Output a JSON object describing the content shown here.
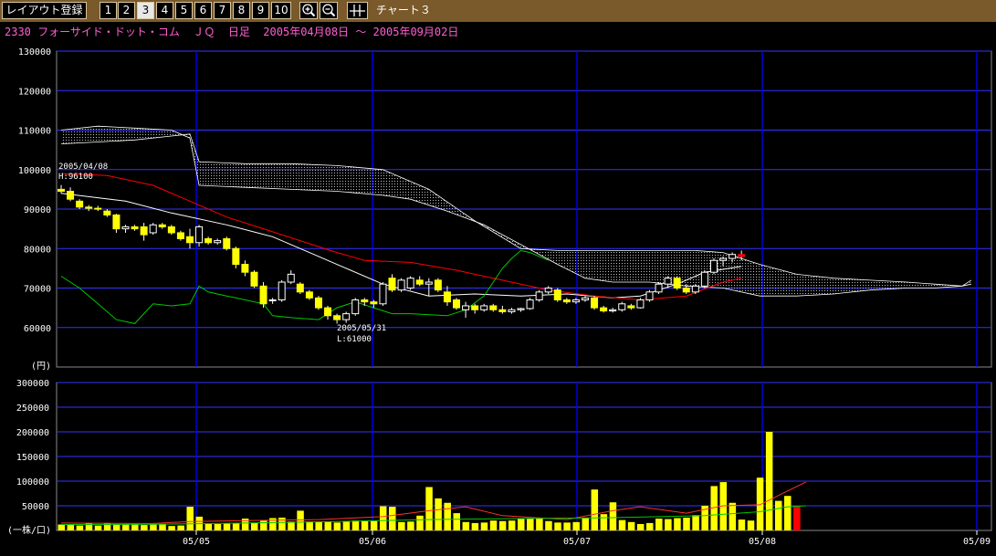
{
  "toolbar": {
    "layout_label": "レイアウト登録",
    "numbers": [
      "1",
      "2",
      "3",
      "4",
      "5",
      "6",
      "7",
      "8",
      "9",
      "10"
    ],
    "active_number": "3",
    "chart_title": "チャート３"
  },
  "header": {
    "code": "2330",
    "name": "フォーサイド・ドット・コム",
    "market": "ＪＱ",
    "period_type": "日足",
    "range": "2005年04月08日 ～ 2005年09月02日"
  },
  "colors": {
    "candle_up": "#ffffff",
    "candle_down": "#ffff00",
    "cloud": "#ffffff",
    "ma_short": "#ffffff",
    "ma_long": "#ff0000",
    "lagging_span": "#00c800",
    "volume_bar": "#ffff00",
    "volume_last": "#ff0000",
    "grid_vertical": "#0000ff",
    "grid_horizontal": "#3333ff"
  },
  "chart_data": [
    {
      "type": "candlestick",
      "yunit_label": "(円)",
      "ylim": [
        50000,
        130000
      ],
      "yticks": [
        60000,
        70000,
        80000,
        90000,
        100000,
        110000,
        120000,
        130000
      ],
      "xticks": [
        "05/05",
        "05/06",
        "05/07",
        "05/08",
        "05/09"
      ],
      "annotations": [
        {
          "date": "2005/04/08",
          "label": "H:96100"
        },
        {
          "date": "2005/05/31",
          "label": "L:61000"
        }
      ],
      "candles": [
        [
          95000,
          96100,
          94000,
          94500
        ],
        [
          94500,
          95500,
          92000,
          92500
        ],
        [
          92000,
          92500,
          90000,
          90500
        ],
        [
          90500,
          91000,
          89500,
          90200
        ],
        [
          90200,
          90800,
          89500,
          90000
        ],
        [
          89500,
          90000,
          88000,
          88500
        ],
        [
          88500,
          88800,
          84000,
          85000
        ],
        [
          85000,
          86000,
          84000,
          85500
        ],
        [
          85500,
          86000,
          84500,
          85000
        ],
        [
          85500,
          86500,
          82000,
          83500
        ],
        [
          84000,
          86500,
          83500,
          86000
        ],
        [
          86000,
          86500,
          85000,
          85500
        ],
        [
          85500,
          86000,
          83500,
          84000
        ],
        [
          84000,
          84500,
          82000,
          82500
        ],
        [
          83000,
          85000,
          80000,
          81500
        ],
        [
          81500,
          86000,
          80500,
          85500
        ],
        [
          82500,
          83000,
          81000,
          81500
        ],
        [
          81500,
          82500,
          81000,
          82000
        ],
        [
          82500,
          83000,
          79500,
          80000
        ],
        [
          80000,
          80500,
          75000,
          76000
        ],
        [
          76000,
          77000,
          73000,
          74000
        ],
        [
          74000,
          74500,
          70000,
          70500
        ],
        [
          70500,
          71500,
          65000,
          66000
        ],
        [
          67000,
          67500,
          66000,
          67000
        ],
        [
          67000,
          72000,
          66500,
          71500
        ],
        [
          71500,
          74500,
          71000,
          73500
        ],
        [
          71000,
          71500,
          68500,
          69000
        ],
        [
          69000,
          69500,
          67000,
          67500
        ],
        [
          67500,
          68000,
          64500,
          65000
        ],
        [
          65000,
          65500,
          62000,
          63000
        ],
        [
          63000,
          63500,
          61000,
          62000
        ],
        [
          62000,
          64000,
          61200,
          63500
        ],
        [
          63500,
          67500,
          63000,
          67000
        ],
        [
          67000,
          67500,
          65500,
          66500
        ],
        [
          66500,
          67000,
          65000,
          66000
        ],
        [
          66000,
          71500,
          65500,
          71000
        ],
        [
          72500,
          73500,
          69000,
          69500
        ],
        [
          69500,
          72500,
          69000,
          72000
        ],
        [
          70000,
          73000,
          69500,
          72500
        ],
        [
          72000,
          73000,
          70500,
          71000
        ],
        [
          71000,
          72500,
          68000,
          71500
        ],
        [
          72000,
          72500,
          69000,
          69500
        ],
        [
          69000,
          70500,
          65500,
          66500
        ],
        [
          67000,
          67500,
          64500,
          65000
        ],
        [
          64500,
          66500,
          62500,
          65500
        ],
        [
          65500,
          66000,
          63500,
          64500
        ],
        [
          64500,
          66000,
          64000,
          65500
        ],
        [
          65500,
          66000,
          64000,
          64500
        ],
        [
          64500,
          65500,
          63500,
          64000
        ],
        [
          64000,
          65000,
          63500,
          64500
        ],
        [
          64500,
          65000,
          64000,
          64800
        ],
        [
          64800,
          67500,
          64500,
          67000
        ],
        [
          67000,
          69500,
          66500,
          69000
        ],
        [
          69000,
          70500,
          68500,
          70000
        ],
        [
          69500,
          70000,
          66500,
          67000
        ],
        [
          67000,
          67500,
          66000,
          66500
        ],
        [
          66500,
          67500,
          66000,
          67000
        ],
        [
          67000,
          68000,
          66500,
          67500
        ],
        [
          67500,
          68000,
          64500,
          65000
        ],
        [
          65000,
          65500,
          63800,
          64200
        ],
        [
          64200,
          65000,
          63800,
          64500
        ],
        [
          64500,
          66500,
          64000,
          66000
        ],
        [
          65500,
          66000,
          64500,
          65000
        ],
        [
          65000,
          67500,
          64800,
          67000
        ],
        [
          67000,
          69500,
          66500,
          69000
        ],
        [
          69000,
          71500,
          68500,
          71000
        ],
        [
          71000,
          73000,
          70000,
          72500
        ],
        [
          72500,
          73000,
          69500,
          70000
        ],
        [
          70000,
          71000,
          68500,
          69000
        ],
        [
          69000,
          71000,
          68500,
          70500
        ],
        [
          70500,
          74500,
          70000,
          74000
        ],
        [
          74000,
          77500,
          73500,
          77000
        ],
        [
          77000,
          78000,
          75500,
          77500
        ],
        [
          77500,
          79000,
          76500,
          78500
        ],
        [
          78500,
          79500,
          77000,
          78000
        ]
      ],
      "series": [
        {
          "name": "",
          "values": [
            [
              0,
              94000
            ],
            [
              7,
              92000
            ],
            [
              12,
              89000
            ],
            [
              18,
              86000
            ],
            [
              23,
              83000
            ],
            [
              27,
              79000
            ],
            [
              31,
              75000
            ],
            [
              35,
              71000
            ],
            [
              40,
              68000
            ],
            [
              45,
              68500
            ],
            [
              50,
              68000
            ],
            [
              55,
              68500
            ],
            [
              60,
              67500
            ],
            [
              63,
              68000
            ],
            [
              67,
              71000
            ],
            [
              70,
              74000
            ],
            [
              74,
              75500
            ]
          ]
        },
        {
          "name": "",
          "values": [
            [
              0,
              99000
            ],
            [
              5,
              98500
            ],
            [
              10,
              96000
            ],
            [
              14,
              92000
            ],
            [
              18,
              88000
            ],
            [
              22,
              85000
            ],
            [
              26,
              82000
            ],
            [
              30,
              79000
            ],
            [
              33,
              77000
            ],
            [
              38,
              76500
            ],
            [
              43,
              74500
            ],
            [
              48,
              72000
            ],
            [
              53,
              69500
            ],
            [
              58,
              68000
            ],
            [
              63,
              67000
            ],
            [
              68,
              68000
            ],
            [
              72,
              71500
            ],
            [
              74,
              72500
            ]
          ]
        },
        {
          "name": "",
          "values": [
            [
              0,
              73000
            ],
            [
              2,
              70000
            ],
            [
              4,
              66000
            ],
            [
              6,
              62000
            ],
            [
              8,
              61000
            ],
            [
              10,
              66000
            ],
            [
              12,
              65500
            ],
            [
              14,
              66000
            ],
            [
              15,
              70500
            ],
            [
              16,
              69000
            ],
            [
              18,
              68000
            ],
            [
              19,
              67500
            ],
            [
              22,
              66000
            ],
            [
              23,
              63000
            ],
            [
              25,
              62500
            ],
            [
              28,
              62000
            ],
            [
              30,
              65000
            ],
            [
              32,
              66500
            ],
            [
              36,
              63500
            ],
            [
              38,
              63500
            ],
            [
              42,
              63000
            ],
            [
              44,
              64500
            ],
            [
              46,
              68000
            ],
            [
              48,
              75000
            ],
            [
              49,
              77500
            ],
            [
              50,
              79500
            ],
            [
              51,
              79000
            ],
            [
              52,
              78000
            ],
            [
              53,
              77000
            ]
          ]
        },
        {
          "name": "",
          "values": [
            [
              0,
              106500
            ],
            [
              4,
              107000
            ],
            [
              8,
              107500
            ],
            [
              12,
              108500
            ],
            [
              14,
              109000
            ],
            [
              15,
              102000
            ],
            [
              20,
              101500
            ],
            [
              25,
              101500
            ],
            [
              30,
              101000
            ],
            [
              35,
              100000
            ],
            [
              40,
              95000
            ],
            [
              45,
              87000
            ],
            [
              50,
              80000
            ],
            [
              54,
              79500
            ],
            [
              58,
              79500
            ],
            [
              61,
              79500
            ],
            [
              65,
              79500
            ],
            [
              69,
              79500
            ],
            [
              72,
              79000
            ],
            [
              76,
              76000
            ],
            [
              80,
              73500
            ],
            [
              84,
              72500
            ],
            [
              88,
              72000
            ],
            [
              92,
              71500
            ],
            [
              95,
              71000
            ],
            [
              98,
              70500
            ],
            [
              99,
              72000
            ]
          ]
        },
        {
          "name": "",
          "values": [
            [
              0,
              110000
            ],
            [
              4,
              111000
            ],
            [
              8,
              110500
            ],
            [
              12,
              110000
            ],
            [
              14,
              108000
            ],
            [
              15,
              96000
            ],
            [
              20,
              95500
            ],
            [
              25,
              95000
            ],
            [
              30,
              94500
            ],
            [
              35,
              93500
            ],
            [
              38,
              92500
            ],
            [
              42,
              89500
            ],
            [
              46,
              86000
            ],
            [
              50,
              81000
            ],
            [
              54,
              76000
            ],
            [
              57,
              72500
            ],
            [
              60,
              71500
            ],
            [
              64,
              71500
            ],
            [
              68,
              70500
            ],
            [
              72,
              70000
            ],
            [
              76,
              68000
            ],
            [
              80,
              68000
            ],
            [
              84,
              68500
            ],
            [
              88,
              69500
            ],
            [
              92,
              70000
            ],
            [
              95,
              70000
            ],
            [
              98,
              70500
            ],
            [
              99,
              71000
            ]
          ]
        }
      ]
    },
    {
      "type": "bar",
      "yunit_label": "(一株/口)",
      "ylim": [
        0,
        300000
      ],
      "yticks": [
        50000,
        100000,
        150000,
        200000,
        250000,
        300000
      ],
      "values": [
        12000,
        12000,
        10000,
        15000,
        10000,
        15000,
        13000,
        12000,
        13000,
        11000,
        12000,
        12000,
        9000,
        10000,
        48000,
        28000,
        14000,
        13000,
        14000,
        14000,
        24000,
        15000,
        21000,
        25000,
        26000,
        18000,
        40000,
        18000,
        17000,
        18000,
        16000,
        19000,
        20000,
        20000,
        20000,
        49000,
        48000,
        17000,
        18000,
        30000,
        88000,
        65000,
        56000,
        35000,
        17000,
        15000,
        16000,
        20000,
        19000,
        20000,
        24000,
        24000,
        24000,
        19000,
        16000,
        16000,
        17000,
        25000,
        83000,
        33000,
        57000,
        21000,
        17000,
        13000,
        15000,
        24000,
        23000,
        25000,
        26000,
        31000,
        50000,
        90000,
        98000,
        56000,
        22000,
        20000,
        107000,
        200000,
        60000,
        70000,
        48000
      ],
      "series": [
        {
          "name": "",
          "values": [
            [
              0,
              15000
            ],
            [
              10,
              14000
            ],
            [
              14,
              18000
            ],
            [
              20,
              20000
            ],
            [
              28,
              22000
            ],
            [
              35,
              28000
            ],
            [
              40,
              40000
            ],
            [
              44,
              48000
            ],
            [
              48,
              30000
            ],
            [
              55,
              22000
            ],
            [
              60,
              40000
            ],
            [
              63,
              48000
            ],
            [
              68,
              35000
            ],
            [
              72,
              50000
            ],
            [
              76,
              52000
            ],
            [
              79,
              80000
            ],
            [
              81,
              98000
            ]
          ]
        },
        {
          "name": "",
          "values": [
            [
              0,
              12000
            ],
            [
              10,
              12500
            ],
            [
              20,
              15000
            ],
            [
              30,
              18000
            ],
            [
              40,
              22000
            ],
            [
              50,
              24000
            ],
            [
              60,
              26000
            ],
            [
              70,
              30000
            ],
            [
              76,
              38000
            ],
            [
              79,
              48000
            ],
            [
              81,
              50000
            ]
          ]
        }
      ]
    }
  ]
}
